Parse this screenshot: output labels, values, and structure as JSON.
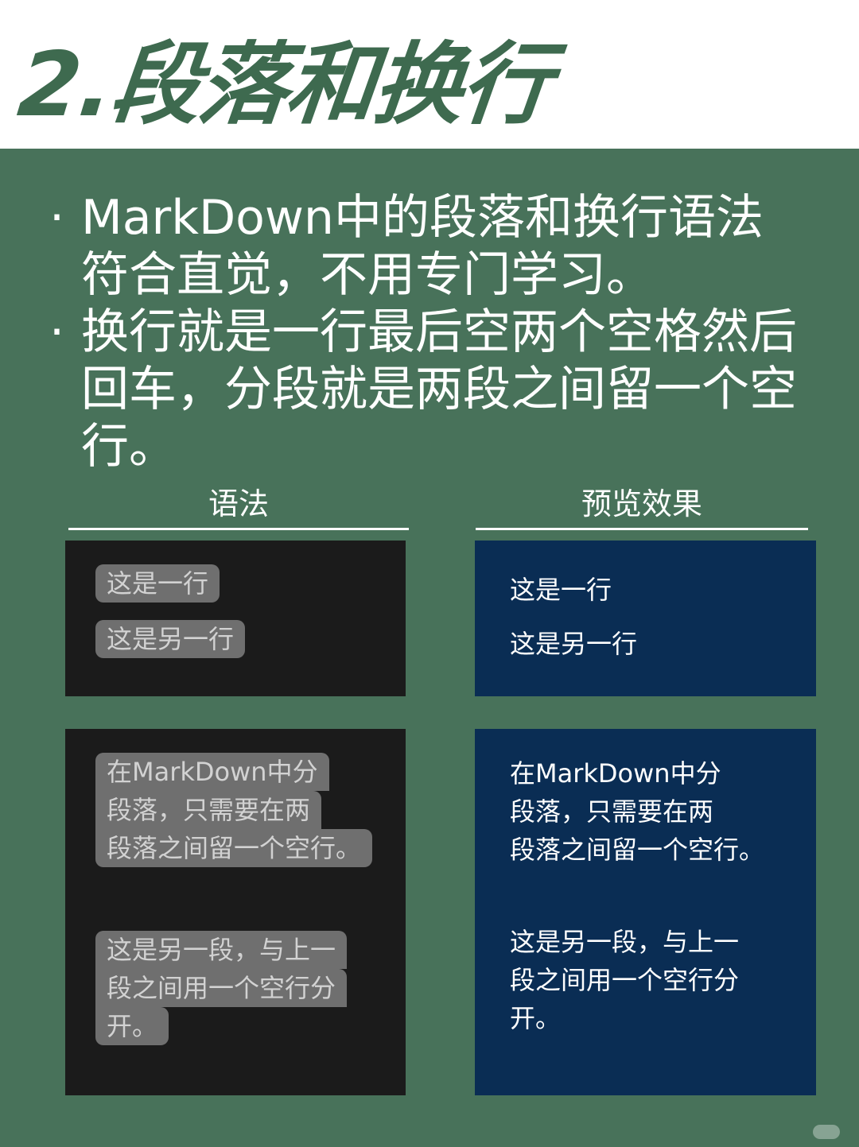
{
  "title": "2.段落和换行",
  "bullets": [
    {
      "dot": "·",
      "lines": [
        "MarkDown中的段落和换行语法",
        "符合直觉，不用专门学习。"
      ]
    },
    {
      "dot": "·",
      "lines": [
        "换行就是一行最后空两个空格然后",
        "回车，分段就是两段之间留一个空",
        "行。"
      ]
    }
  ],
  "columns": {
    "syntax_label": "语法",
    "preview_label": "预览效果"
  },
  "example1": {
    "lines": [
      "这是一行",
      "这是另一行"
    ]
  },
  "example2": {
    "para1_lines": [
      "在MarkDown中分",
      "段落，只需要在两",
      "段落之间留一个空行。"
    ],
    "para2_lines": [
      "这是另一段，与上一",
      "段之间用一个空行分",
      "开。"
    ]
  },
  "colors": {
    "background": "#48725A",
    "title": "#3E6A4F",
    "syntax_panel": "#1B1B1B",
    "preview_panel": "#0A2D54",
    "chip": "#6F6F6F"
  }
}
